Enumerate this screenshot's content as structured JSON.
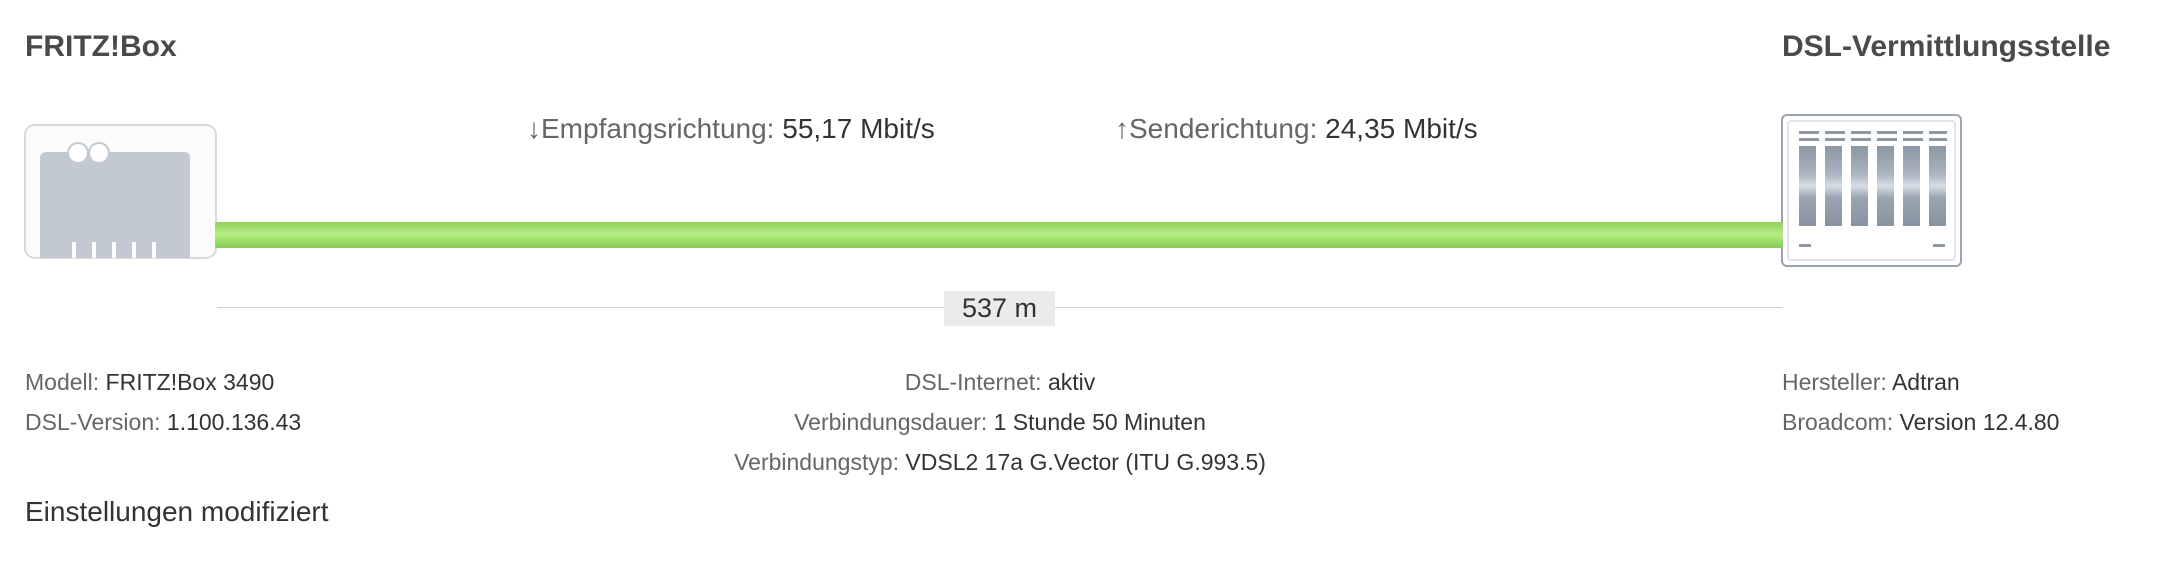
{
  "fritzbox": {
    "title": "FRITZ!Box",
    "model_label": "Modell:",
    "model_value": "FRITZ!Box 3490",
    "dsl_version_label": "DSL-Version:",
    "dsl_version_value": "1.100.136.43"
  },
  "exchange": {
    "title": "DSL-Vermittlungsstelle",
    "manufacturer_label": "Hersteller:",
    "manufacturer_value": "Adtran",
    "broadcom_label": "Broadcom:",
    "broadcom_value": "Version 12.4.80"
  },
  "rates": {
    "down_arrow": "↓",
    "down_label": "Empfangsrichtung:",
    "down_value": "55,17 Mbit/s",
    "up_arrow": "↑",
    "up_label": "Senderichtung:",
    "up_value": "24,35 Mbit/s"
  },
  "line": {
    "distance": "537 m",
    "color": "#a5e076"
  },
  "connection": {
    "internet_label": "DSL-Internet:",
    "internet_value": "aktiv",
    "duration_label": "Verbindungsdauer:",
    "duration_value": "1 Stunde 50 Minuten",
    "type_label": "Verbindungstyp:",
    "type_value": "VDSL2 17a G.Vector (ITU G.993.5)"
  },
  "settings_note": "Einstellungen modifiziert",
  "icons": {
    "router": "router-icon",
    "exchange": "exchange-icon"
  }
}
